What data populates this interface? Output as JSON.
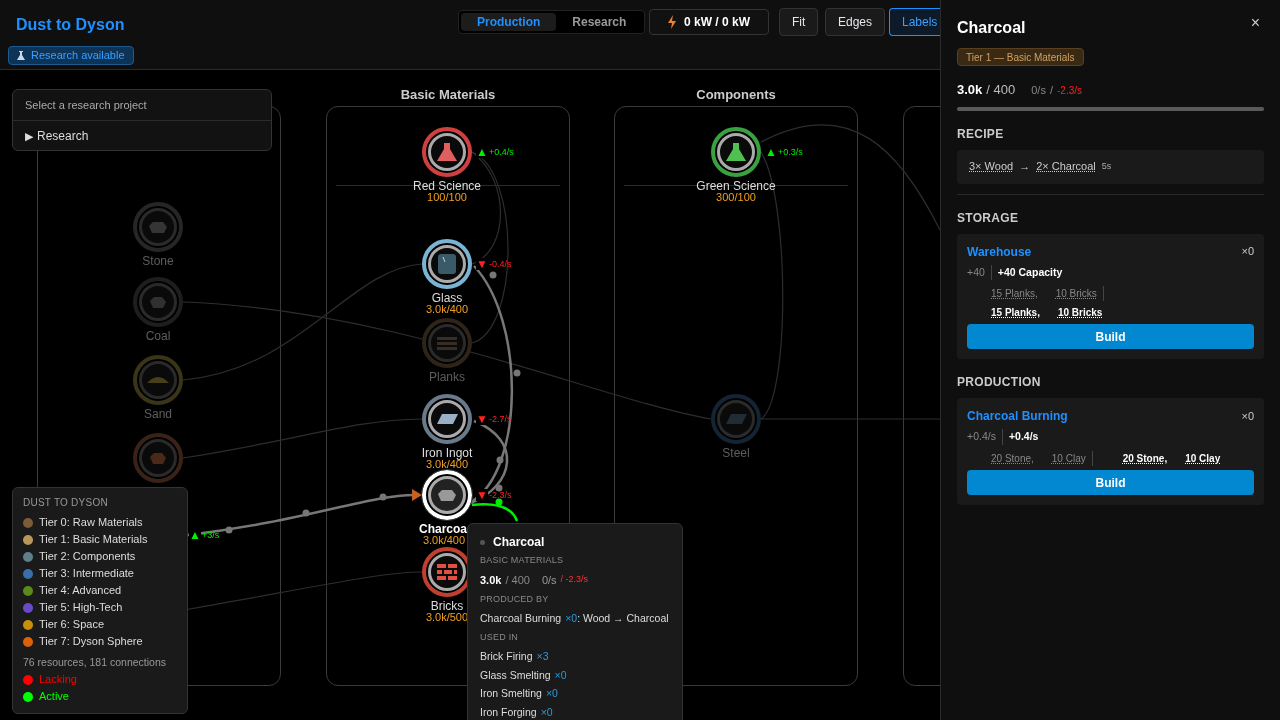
{
  "header": {
    "title": "Dust to Dyson",
    "research_badge": "Research available",
    "view_tabs": [
      {
        "label": "Production",
        "selected": true
      },
      {
        "label": "Research",
        "selected": false
      }
    ],
    "power": "0 kW / 0 kW",
    "buttons": [
      {
        "label": "Fit",
        "active": false
      },
      {
        "label": "Edges",
        "active": false
      },
      {
        "label": "Labels",
        "active": true
      }
    ]
  },
  "research_dropdown": {
    "placeholder": "Select a research project",
    "toggle": "▶",
    "label": "Research"
  },
  "graph": {
    "groups": [
      {
        "kind": "frame"
      },
      {
        "kind": "titled",
        "title": "Basic Materials"
      },
      {
        "kind": "titled",
        "title": "Components"
      },
      {
        "kind": "frame"
      }
    ],
    "nodes": [
      {
        "name": "Stone",
        "dimmed": true,
        "selected": false,
        "color": "#262626"
      },
      {
        "name": "Coal",
        "dimmed": true,
        "selected": false,
        "color": "#1e1e1e"
      },
      {
        "name": "Sand",
        "dimmed": true,
        "selected": false,
        "color": "#3a3418"
      },
      {
        "dimmed": true,
        "selected": false,
        "color": "#3a2218"
      },
      {
        "name": "Red Science",
        "amount": "100/100",
        "rate": {
          "trend": "▲",
          "value": "+0.4/s",
          "color": "#00ee00"
        },
        "dimmed": false,
        "selected": false,
        "color": "#d04040"
      },
      {
        "name": "Glass",
        "amount": "3.0k/400",
        "rate": {
          "trend": "▼",
          "value": "-0.4/s",
          "color": "#ff2020"
        },
        "dimmed": false,
        "selected": false,
        "color": "#7ab4d4"
      },
      {
        "name": "Planks",
        "dimmed": true,
        "selected": false,
        "color": "#2e2418"
      },
      {
        "name": "Iron Ingot",
        "amount": "3.0k/400",
        "rate": {
          "trend": "▼",
          "value": "-2.7/s",
          "color": "#ff2020"
        },
        "dimmed": false,
        "selected": false,
        "color": "#6a7a8a"
      },
      {
        "name": "Charcoa",
        "amount": "3.0k/400",
        "rate": {
          "trend": "▼",
          "value": "-2.3/s",
          "color": "#ff2020"
        },
        "dimmed": false,
        "selected": true,
        "color": "#ffffff"
      },
      {
        "name": "Bricks",
        "amount": "3.0k/500",
        "dimmed": false,
        "selected": false,
        "color": "#c04030"
      },
      {
        "name": "Green Science",
        "amount": "300/100",
        "rate": {
          "trend": "▲",
          "value": "+0.3/s",
          "color": "#00ee00"
        },
        "dimmed": false,
        "selected": false,
        "color": "#3aa040"
      },
      {
        "name": "Steel",
        "dimmed": true,
        "selected": false,
        "color": "#142434"
      },
      {
        "rate": {
          "trend": "▲",
          "value": "+3/s",
          "color": "#00ee00"
        }
      }
    ]
  },
  "legend": {
    "title": "DUST TO DYSON",
    "tiers": [
      {
        "label": "Tier 0: Raw Materials",
        "color": "#7a5c3a"
      },
      {
        "label": "Tier 1: Basic Materials",
        "color": "#b8975a"
      },
      {
        "label": "Tier 2: Components",
        "color": "#5f7f8c"
      },
      {
        "label": "Tier 3: Intermediate",
        "color": "#3a6ea8"
      },
      {
        "label": "Tier 4: Advanced",
        "color": "#5a8a1a"
      },
      {
        "label": "Tier 5: High-Tech",
        "color": "#6a4ac8"
      },
      {
        "label": "Tier 6: Space",
        "color": "#c8900a"
      },
      {
        "label": "Tier 7: Dyson Sphere",
        "color": "#e0600a"
      }
    ],
    "stats": "76 resources, 181 connections",
    "statuses": [
      {
        "label": "Lacking",
        "color": "#ff0000"
      },
      {
        "label": "Active",
        "color": "#00ff00"
      }
    ]
  },
  "tooltip": {
    "title": "Charcoal",
    "category": "BASIC MATERIALS",
    "amount": "3.0k",
    "capacity": "/ 400",
    "rate": "0/s",
    "drain": "/ -2.3/s",
    "produced_by_heading": "PRODUCED BY",
    "produced_by": {
      "name": "Charcoal Burning",
      "count": "×0",
      "recipe": ": Wood → Charcoal"
    },
    "used_in_heading": "USED IN",
    "used_in": [
      {
        "name": "Brick Firing",
        "count": "×3"
      },
      {
        "name": "Glass Smelting",
        "count": "×0"
      },
      {
        "name": "Iron Smelting",
        "count": "×0"
      },
      {
        "name": "Iron Forging",
        "count": "×0"
      }
    ]
  },
  "details": {
    "title": "Charcoal",
    "close": "×",
    "tier": "Tier 1 — Basic Materials",
    "amount": "3.0k",
    "capacity": "/ 400",
    "rate": "0/s",
    "drain_separator": "/",
    "drain": "-2.3/s",
    "level": 1,
    "recipe_heading": "RECIPE",
    "recipe": {
      "input": "3× Wood",
      "arrow": "→",
      "output": "2× Charcoal",
      "time": "5s"
    },
    "sections": [
      {
        "heading": "STORAGE",
        "kind": "stacked",
        "building": {
          "name": "Warehouse",
          "count": "×0",
          "effect_base": "+40",
          "effect": "+40 Capacity",
          "cost_base": [
            "15 Planks,",
            "10 Bricks"
          ],
          "cost": [
            "15 Planks,",
            "10 Bricks"
          ],
          "button": "Build"
        }
      },
      {
        "heading": "PRODUCTION",
        "kind": "inline",
        "building": {
          "name": "Charcoal Burning",
          "count": "×0",
          "effect_base": "+0.4/s",
          "effect": "+0.4/s",
          "cost_base": [
            "20 Stone,",
            "10 Clay"
          ],
          "cost": [
            "20 Stone,",
            "10 Clay"
          ],
          "button": "Build"
        }
      }
    ]
  }
}
